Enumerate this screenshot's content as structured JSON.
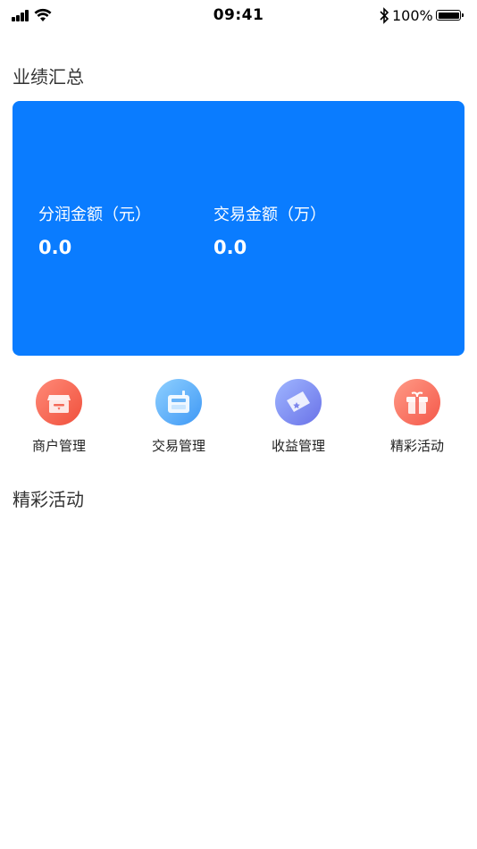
{
  "status_bar": {
    "time": "09:41",
    "battery": "100%",
    "icons": [
      "signal-icon",
      "wifi-icon",
      "bluetooth-icon",
      "battery-icon"
    ]
  },
  "summary": {
    "title": "业绩汇总",
    "card_color": "#0A7CFF",
    "metrics": [
      {
        "label": "分润金额（元）",
        "value": "0.0"
      },
      {
        "label": "交易金额（万）",
        "value": "0.0"
      }
    ]
  },
  "quick_menu": [
    {
      "label": "商户管理",
      "icon": "store-icon",
      "color": "#F0503C"
    },
    {
      "label": "交易管理",
      "icon": "pos-terminal-icon",
      "color": "#3E98F5"
    },
    {
      "label": "收益管理",
      "icon": "ticket-icon",
      "color": "#6A72E8"
    },
    {
      "label": "精彩活动",
      "icon": "gift-icon",
      "color": "#F4584A"
    }
  ],
  "activities": {
    "title": "精彩活动"
  }
}
